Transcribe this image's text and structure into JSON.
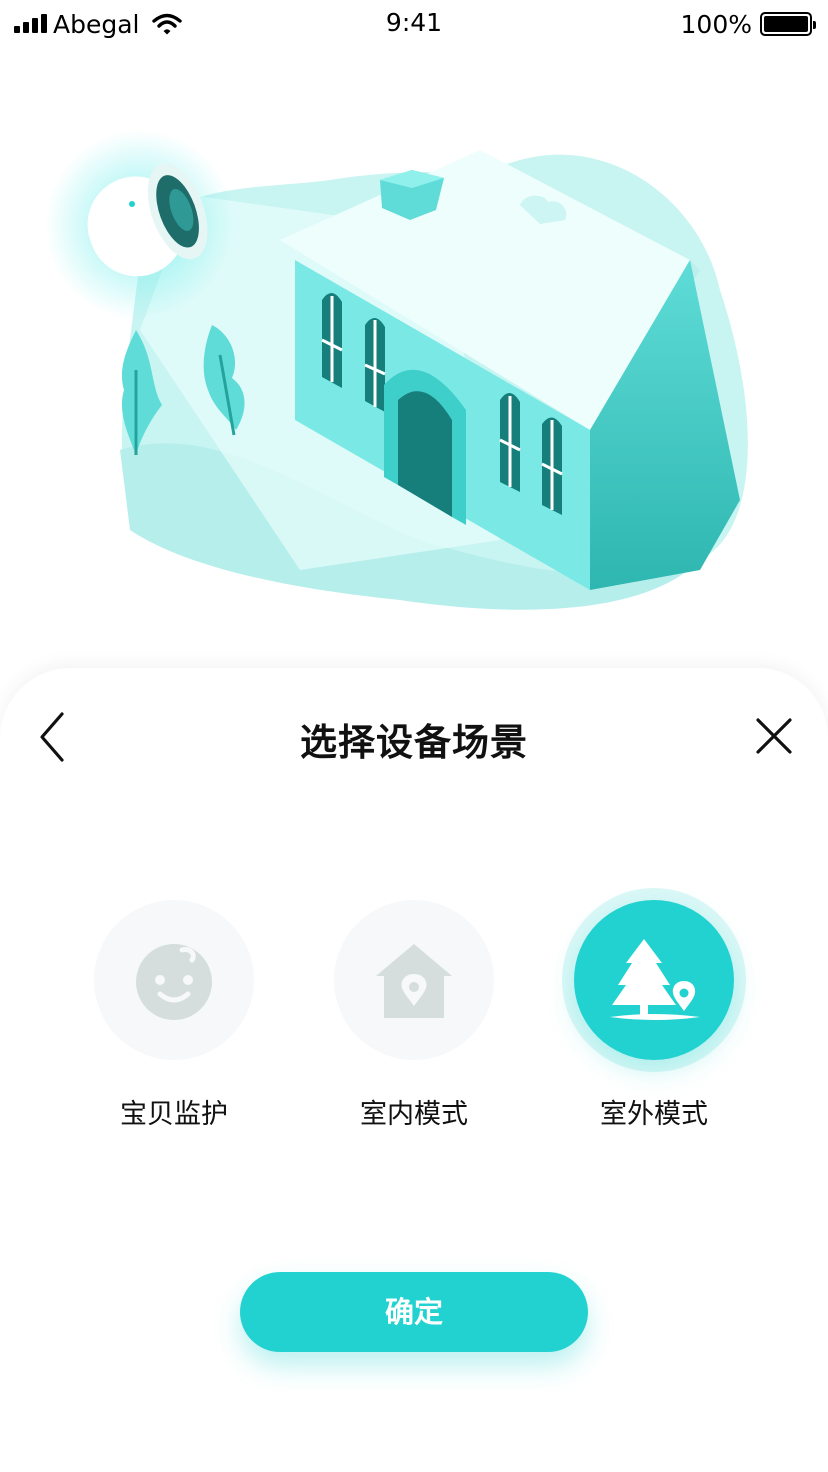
{
  "status_bar": {
    "carrier": "Abegal",
    "time": "9:41",
    "battery": "100%"
  },
  "colors": {
    "accent": "#22d2d0",
    "inactive_circle": "#f6f8f9",
    "inactive_icon": "#d6dedd"
  },
  "header": {
    "title": "选择设备场景",
    "back_icon": "chevron-left-icon",
    "close_icon": "close-icon"
  },
  "modes": [
    {
      "label": "宝贝监护",
      "icon": "baby-face-icon",
      "selected": false
    },
    {
      "label": "室内模式",
      "icon": "house-location-icon",
      "selected": false
    },
    {
      "label": "室外模式",
      "icon": "tree-location-icon",
      "selected": true
    }
  ],
  "confirm": {
    "label": "确定"
  }
}
